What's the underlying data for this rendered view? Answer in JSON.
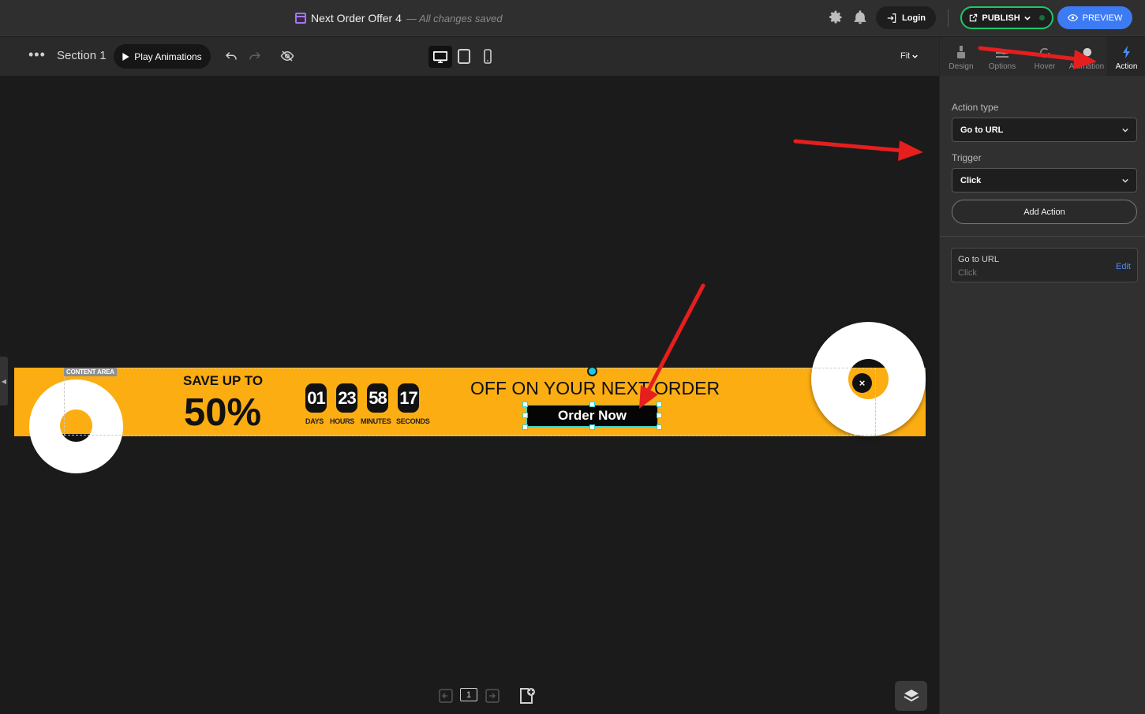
{
  "header": {
    "doc_title": "Next Order Offer 4",
    "save_status": "— All changes saved",
    "login_label": "Login",
    "publish_label": "PUBLISH",
    "preview_label": "PREVIEW",
    "icons": [
      "gear-icon",
      "bell-icon",
      "login-icon",
      "external-link-icon",
      "eye-icon"
    ]
  },
  "toolbar": {
    "section_label": "Section 1",
    "play_label": "Play Animations",
    "zoom_label": "Fit",
    "devices": [
      "desktop",
      "tablet",
      "mobile"
    ],
    "active_device": "desktop"
  },
  "panel": {
    "tabs": [
      {
        "label": "Design",
        "icon": "brush-icon"
      },
      {
        "label": "Options",
        "icon": "sliders-icon"
      },
      {
        "label": "Hover",
        "icon": "hover-icon"
      },
      {
        "label": "Animation",
        "icon": "animation-icon"
      },
      {
        "label": "Action",
        "icon": "bolt-icon"
      }
    ],
    "active_tab": "Action",
    "action_type_label": "Action type",
    "action_type_value": "Go to URL",
    "trigger_label": "Trigger",
    "trigger_value": "Click",
    "add_action_label": "Add Action",
    "card": {
      "title": "Go to URL",
      "subtitle": "Click",
      "edit_label": "Edit"
    }
  },
  "canvas": {
    "content_area_tag": "CONTENT AREA",
    "save_text": "SAVE UP TO",
    "discount_text": "50%",
    "countdown": [
      {
        "value": "01",
        "label": "DAYS"
      },
      {
        "value": "23",
        "label": "HOURS"
      },
      {
        "value": "58",
        "label": "MINUTES"
      },
      {
        "value": "17",
        "label": "SECONDS"
      }
    ],
    "offer_text": "OFF ON YOUR NEXT ORDER",
    "button_label": "Order Now",
    "close_symbol": "×"
  },
  "colors": {
    "banner": "#fbad12",
    "accent_blue": "#3d7bf5",
    "publish_green": "#1fc76b",
    "selection": "#2ad4d4",
    "annotation_arrow": "#e61e1e"
  },
  "bottom": {
    "page_number": "1"
  }
}
